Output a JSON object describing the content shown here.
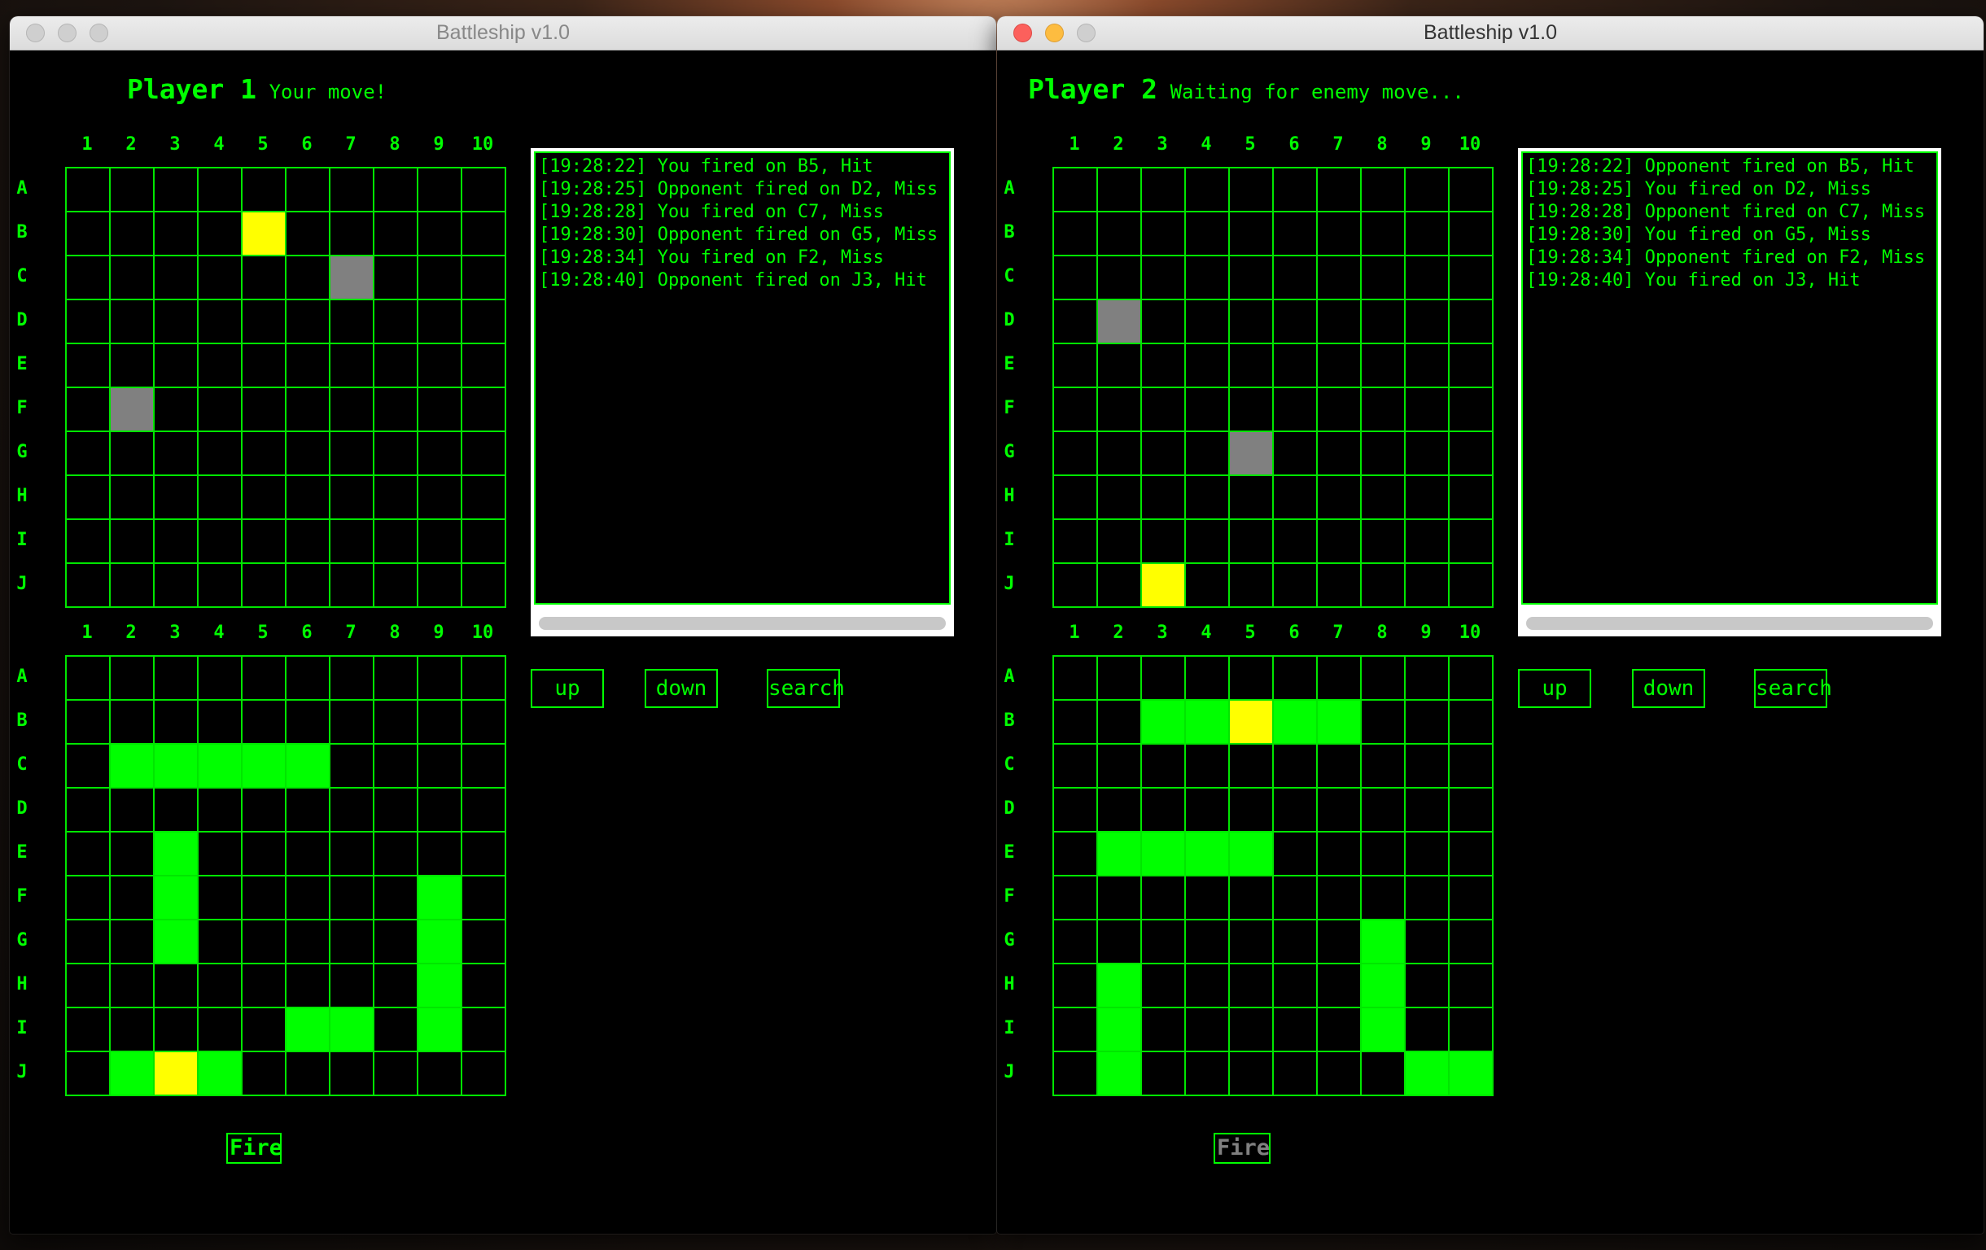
{
  "colors": {
    "accent": "#00ff00",
    "miss": "#808080",
    "hit": "#ffff00",
    "ship": "#00ff00"
  },
  "cols": [
    "1",
    "2",
    "3",
    "4",
    "5",
    "6",
    "7",
    "8",
    "9",
    "10"
  ],
  "rows": [
    "A",
    "B",
    "C",
    "D",
    "E",
    "F",
    "G",
    "H",
    "I",
    "J"
  ],
  "buttons": {
    "up": "up",
    "down": "down",
    "search": "search",
    "fire": "Fire"
  },
  "windows": [
    {
      "title": "Battleship v1.0",
      "player": "Player 1",
      "status": "Your move!",
      "top_grid": {
        "miss": [
          "C7",
          "F2"
        ],
        "hit": [
          "B5"
        ],
        "ship": []
      },
      "bottom_grid": {
        "miss": [],
        "hit": [
          "J3"
        ],
        "ship": [
          "C2",
          "C3",
          "C4",
          "C5",
          "C6",
          "E3",
          "F3",
          "G3",
          "F9",
          "G9",
          "H9",
          "I9",
          "I6",
          "I7",
          "J2",
          "J4"
        ]
      },
      "log": [
        "[19:28:22] You fired on B5, Hit",
        "[19:28:25] Opponent fired on D2, Miss",
        "[19:28:28] You fired on C7, Miss",
        "[19:28:30] Opponent fired on G5, Miss",
        "[19:28:34] You fired on F2, Miss",
        "[19:28:40] Opponent fired on J3, Hit"
      ]
    },
    {
      "title": "Battleship v1.0",
      "player": "Player 2",
      "status": "Waiting for enemy move...",
      "top_grid": {
        "miss": [
          "D2",
          "G5"
        ],
        "hit": [
          "J3"
        ],
        "ship": []
      },
      "bottom_grid": {
        "miss": [],
        "hit": [
          "B5"
        ],
        "ship": [
          "B3",
          "B4",
          "B6",
          "B7",
          "E2",
          "E3",
          "E4",
          "E5",
          "H2",
          "I2",
          "J2",
          "G8",
          "H8",
          "I8",
          "J9",
          "J10"
        ]
      },
      "log": [
        "[19:28:22] Opponent fired on B5, Hit",
        "[19:28:25] You fired on D2, Miss",
        "[19:28:28] Opponent fired on C7, Miss",
        "[19:28:30] You fired on G5, Miss",
        "[19:28:34] Opponent fired on F2, Miss",
        "[19:28:40] You fired on J3, Hit"
      ]
    }
  ]
}
